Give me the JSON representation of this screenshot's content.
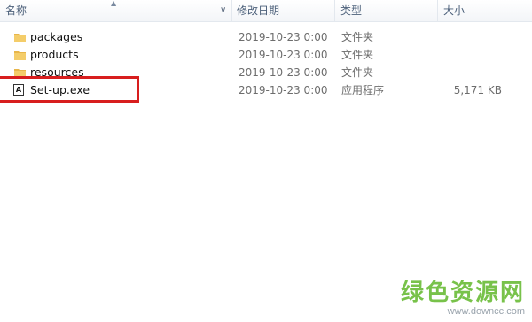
{
  "columns": {
    "name": "名称",
    "date": "修改日期",
    "type": "类型",
    "size": "大小"
  },
  "files": [
    {
      "name": "packages",
      "date": "2019-10-23 0:00",
      "type": "文件夹",
      "size": "",
      "icon": "folder-icon"
    },
    {
      "name": "products",
      "date": "2019-10-23 0:00",
      "type": "文件夹",
      "size": "",
      "icon": "folder-icon"
    },
    {
      "name": "resources",
      "date": "2019-10-23 0:00",
      "type": "文件夹",
      "size": "",
      "icon": "folder-icon"
    },
    {
      "name": "Set-up.exe",
      "date": "2019-10-23 0:00",
      "type": "应用程序",
      "size": "5,171 KB",
      "icon": "adobe-exe-icon"
    }
  ],
  "watermark": {
    "title": "绿色资源网",
    "url": "www.downcc.com"
  },
  "colors": {
    "highlight": "#d81e1e",
    "folder": "#e8b64a",
    "watermark": "#78c24a"
  }
}
